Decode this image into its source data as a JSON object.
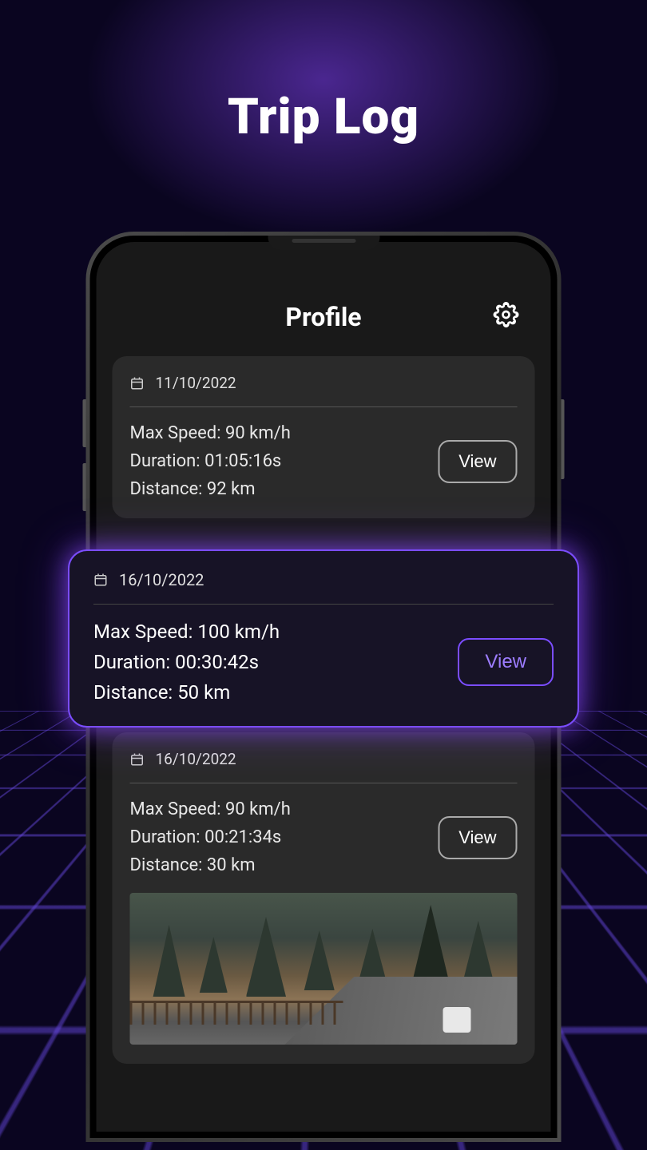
{
  "page": {
    "title": "Trip Log"
  },
  "app": {
    "header_title": "Profile"
  },
  "trips": [
    {
      "date": "11/10/2022",
      "max_speed": "Max Speed: 90 km/h",
      "duration": "Duration: 01:05:16s",
      "distance": "Distance: 92 km",
      "view_label": "View"
    },
    {
      "date": "16/10/2022",
      "max_speed": "Max Speed: 100 km/h",
      "duration": "Duration: 00:30:42s",
      "distance": "Distance: 50 km",
      "view_label": "View"
    },
    {
      "date": "16/10/2022",
      "max_speed": "Max Speed: 90 km/h",
      "duration": "Duration: 00:21:34s",
      "distance": "Distance: 30 km",
      "view_label": "View"
    }
  ]
}
